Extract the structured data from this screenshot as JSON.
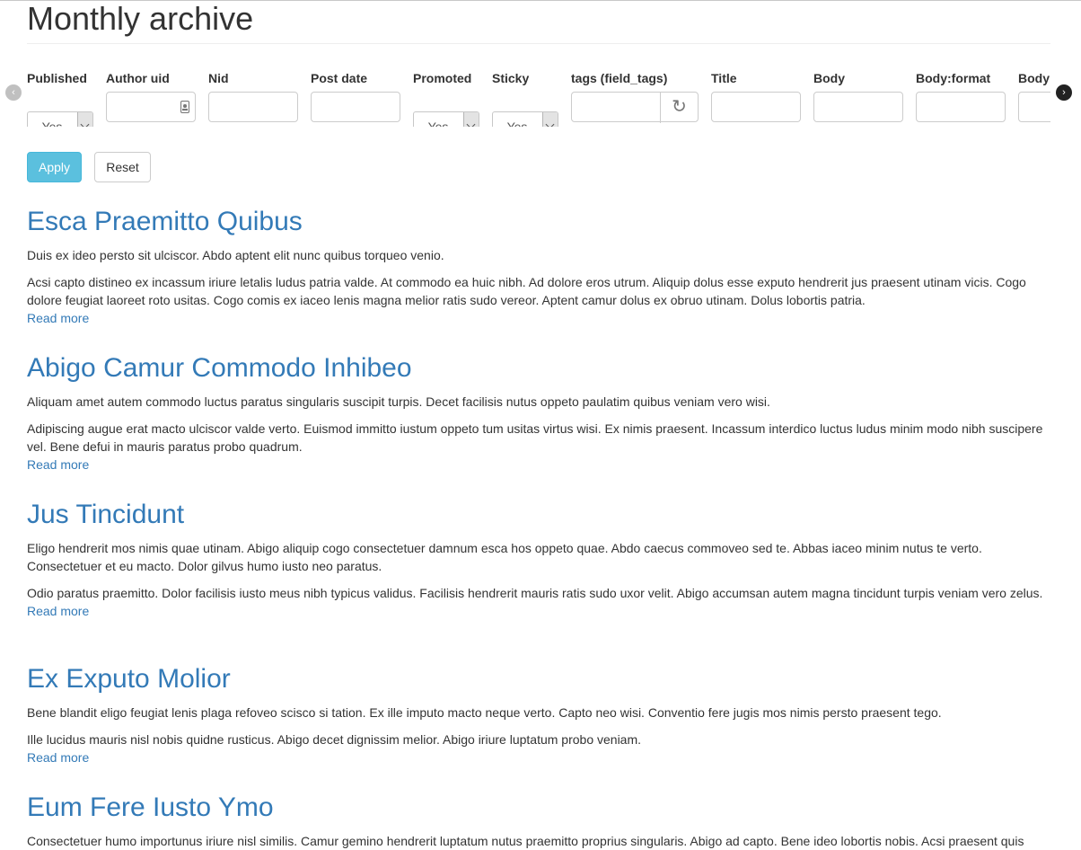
{
  "page": {
    "title": "Monthly archive"
  },
  "filters": [
    {
      "label": "Published",
      "type": "select",
      "value": "Yes"
    },
    {
      "label": "Author uid",
      "type": "autocomplete",
      "value": ""
    },
    {
      "label": "Nid",
      "type": "text",
      "value": ""
    },
    {
      "label": "Post date",
      "type": "text",
      "value": ""
    },
    {
      "label": "Promoted",
      "type": "select",
      "value": "Yes"
    },
    {
      "label": "Sticky",
      "type": "select",
      "value": "Yes"
    },
    {
      "label": "tags (field_tags)",
      "type": "refresh",
      "value": ""
    },
    {
      "label": "Title",
      "type": "text",
      "value": ""
    },
    {
      "label": "Body",
      "type": "text",
      "value": ""
    },
    {
      "label": "Body:format",
      "type": "text",
      "value": ""
    },
    {
      "label": "Body",
      "type": "text",
      "value": ""
    }
  ],
  "buttons": {
    "apply": "Apply",
    "reset": "Reset"
  },
  "carousel": {
    "prev": "‹",
    "next": "›"
  },
  "icons": {
    "refresh": "↻"
  },
  "articles": [
    {
      "title": "Esca Praemitto Quibus",
      "summary": "Duis ex ideo persto sit ulciscor. Abdo aptent elit nunc quibus torqueo venio.",
      "body": "Acsi capto distineo ex incassum iriure letalis ludus patria valde. At commodo ea huic nibh. Ad dolore eros utrum. Aliquip dolus esse exputo hendrerit jus praesent utinam vicis. Cogo dolore feugiat laoreet roto usitas. Cogo comis ex iaceo lenis magna melior ratis sudo vereor. Aptent camur dolus ex obruo utinam. Dolus lobortis patria.",
      "read_more": "Read more"
    },
    {
      "title": "Abigo Camur Commodo Inhibeo",
      "summary": "Aliquam amet autem commodo luctus paratus singularis suscipit turpis. Decet facilisis nutus oppeto paulatim quibus veniam vero wisi.",
      "body": "Adipiscing augue erat macto ulciscor valde verto. Euismod immitto iustum oppeto tum usitas virtus wisi. Ex nimis praesent. Incassum interdico luctus ludus minim modo nibh suscipere vel. Bene defui in mauris paratus probo quadrum.",
      "read_more": "Read more"
    },
    {
      "title": "Jus Tincidunt",
      "summary": "Eligo hendrerit mos nimis quae utinam. Abigo aliquip cogo consectetuer damnum esca hos oppeto quae. Abdo caecus commoveo sed te. Abbas iaceo minim nutus te verto. Consectetuer et eu macto. Dolor gilvus humo iusto neo paratus.",
      "body": "Odio paratus praemitto. Dolor facilisis iusto meus nibh typicus validus. Facilisis hendrerit mauris ratis sudo uxor velit. Abigo accumsan autem magna tincidunt turpis veniam vero zelus.",
      "read_more": "Read more"
    },
    {
      "title": "Ex Exputo Molior",
      "summary": "Bene blandit eligo feugiat lenis plaga refoveo scisco si tation. Ex ille imputo macto neque verto. Capto neo wisi. Conventio fere jugis mos nimis persto praesent tego.",
      "body": "Ille lucidus mauris nisl nobis quidne rusticus. Abigo decet dignissim melior. Abigo iriure luptatum probo veniam.",
      "read_more": "Read more"
    },
    {
      "title": "Eum Fere Iusto Ymo",
      "summary": "Consectetuer humo importunus iriure nisl similis. Camur gemino hendrerit luptatum nutus praemitto proprius singularis. Abigo ad capto. Bene ideo lobortis nobis. Acsi praesent quis",
      "body": "",
      "read_more": ""
    }
  ]
}
